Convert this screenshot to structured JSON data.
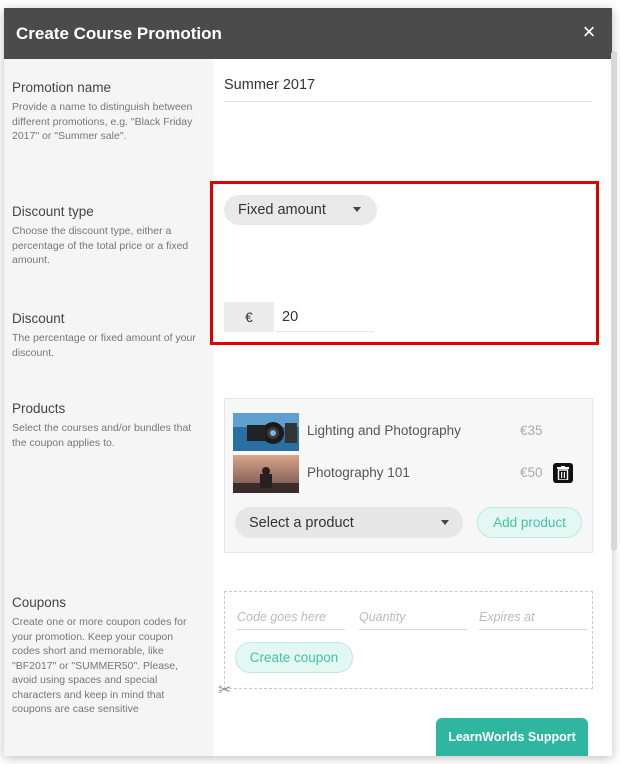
{
  "modal": {
    "title": "Create Course Promotion",
    "close_symbol": "×"
  },
  "promotion_name": {
    "label": "Promotion name",
    "description": "Provide a name to distinguish between different promotions, e.g. \"Black Friday 2017\" or \"Summer sale\".",
    "value": "Summer 2017"
  },
  "discount_type": {
    "label": "Discount type",
    "description": "Choose the discount type, either a percentage of the total price or a fixed amount.",
    "selected": "Fixed amount"
  },
  "discount": {
    "label": "Discount",
    "description": "The percentage or fixed amount of your discount.",
    "currency_symbol": "€",
    "value": "20"
  },
  "products": {
    "label": "Products",
    "description": "Select the courses and/or bundles that the coupon applies to.",
    "items": [
      {
        "name": "Lighting and Photography",
        "price": "€35"
      },
      {
        "name": "Photography 101",
        "price": "€50"
      }
    ],
    "select_placeholder": "Select a product",
    "add_button": "Add product"
  },
  "coupons": {
    "label": "Coupons",
    "description": "Create one or more coupon codes for your promotion. Keep your coupon codes short and memorable, like \"BF2017\" or \"SUMMER50\". Please, avoid using spaces and special characters and keep in mind that coupons are case sensitive",
    "code_placeholder": "Code goes here",
    "quantity_placeholder": "Quantity",
    "expires_placeholder": "Expires at",
    "create_button": "Create coupon"
  },
  "support": {
    "label": "LearnWorlds Support"
  },
  "colors": {
    "header_bg": "#4b4b4b",
    "highlight_border": "#e00000",
    "accent": "#46c1a6",
    "support_bg": "#2fb5a0"
  }
}
